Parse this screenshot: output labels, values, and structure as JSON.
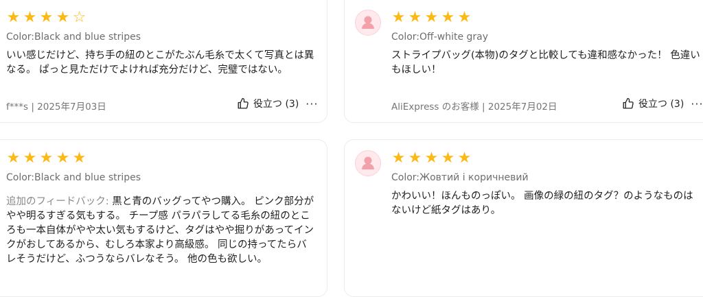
{
  "reviews": [
    {
      "rating": 4,
      "sku": "Color:Black and blue stripes",
      "text": "いい感じだけど、持ち手の紐のとこがたぶん毛糸で太くて写真とは異なる。 ぱっと見ただけでよければ充分だけど、完璧ではない。",
      "meta": "f***s | 2025年7月03日",
      "helpful": "役立つ (3)",
      "more": "···"
    },
    {
      "rating": 5,
      "sku": "Color:Off-white gray",
      "text": "ストライプバッグ(本物)のタグと比較しても違和感なかった！ 色違いもほしい！",
      "meta": "AliExpress のお客様 | 2025年7月02日",
      "helpful": "役立つ (3)",
      "more": "···"
    },
    {
      "rating": 5,
      "sku": "Color:Black and blue stripes",
      "prefix": "追加のフィードバック: ",
      "text": "黒と青のバッグってやつ購入。 ピンク部分がやや明るすぎる気もする。 チープ感 パラパラしてる毛糸の紐のところも一本自体がやや太い気もするけど、タグはやや掘りがあってインクがおしてあるから、むしろ本家より高級感。 同じの持ってたらバレそうだけど、ふつうならバレなそう。 他の色も欲しい。"
    },
    {
      "rating": 5,
      "sku": "Color:Жовтий і коричневий",
      "text": "かわいい！ほんものっぽい。 画像の緑の紐のタグ？のようなものはないけど紙タグはあり。"
    }
  ],
  "colors": {
    "star": "#fdb913",
    "avatar_bg": "#ffe9ec",
    "avatar_icon": "#f2a0aa"
  },
  "icons": {
    "thumb": "thumbs-up-icon",
    "avatar": "user-avatar-icon",
    "more": "more-icon"
  }
}
